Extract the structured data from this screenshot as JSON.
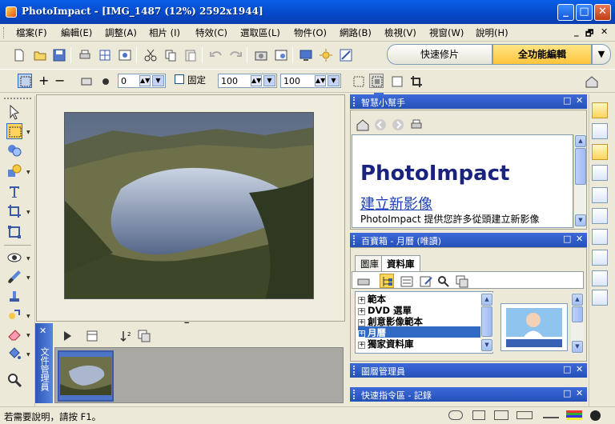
{
  "window": {
    "title": "PhotoImpact - [IMG_1487 (12%) 2592x1944]",
    "minimize": "_",
    "maximize": "□",
    "close": "✕"
  },
  "menu": {
    "items": [
      "檔案(F)",
      "編輯(E)",
      "調整(A)",
      "相片 (I)",
      "特效(C)",
      "選取區(L)",
      "物件(O)",
      "網路(B)",
      "檢視(V)",
      "視窗(W)",
      "說明(H)"
    ],
    "mdi_min": "_",
    "mdi_restore": "🗗",
    "mdi_close": "✕"
  },
  "mode": {
    "quick": "快速修片",
    "full": "全功能編輯",
    "dropdown": "▼"
  },
  "attr_bar": {
    "plus": "+",
    "minus": "−",
    "spin1_value": "0",
    "fixed_label": "固定",
    "width_value": "100",
    "height_value": "100"
  },
  "panels": {
    "help": {
      "title": "智慧小幫手",
      "content_title": "PhotoImpact",
      "link": "建立新影像",
      "desc": "PhotoImpact 提供您許多從頭建立新影像"
    },
    "library": {
      "title": "百寶箱 - 月曆 (唯讀)",
      "tabs": [
        "圖庫",
        "資料庫"
      ],
      "tree": [
        "範本",
        "DVD 選單",
        "創意影像範本",
        "月曆",
        "獨家資料庫"
      ],
      "selected_index": 3
    },
    "layers": {
      "title": "圖層管理員"
    },
    "quick_commands": {
      "title": "快速指令區 - 記錄"
    }
  },
  "doc_manager": {
    "label": "文件管理員",
    "close": "✕"
  },
  "status": {
    "text": "若需要說明，請按 F1。"
  },
  "colors": {
    "title_bar": "#0548c8",
    "panel_header": "#2450b8",
    "mode_active": "#ffc43a",
    "selection": "#316ac5"
  }
}
